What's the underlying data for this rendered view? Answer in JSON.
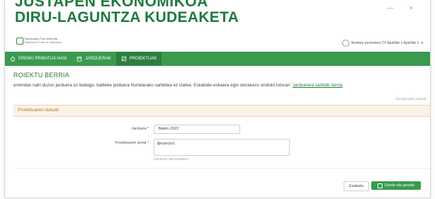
{
  "header": {
    "title_line1": "JUSTAPEN EKONOMIKOA",
    "title_line2": "DIRU-LAGUNTZA KUDEAKETA",
    "logo_line1": "Gipuzkoako Foru Aldundia",
    "logo_line2": "Diputación Foral de Gipuzkoa",
    "window_controls": "— ×",
    "user_label": "Nombre promotora TX Apellido 1 Apellido 2",
    "user_chevron": "▾"
  },
  "nav": {
    "items": [
      {
        "label": "EREMU PRIBATUA HASI",
        "icon": "home-icon"
      },
      {
        "label": "JARDUERAK",
        "icon": "calendar-icon"
      },
      {
        "label": "PROIEKTUAK",
        "icon": "edit-icon"
      }
    ],
    "active_index": 2
  },
  "page": {
    "title": "ROIEKTU BERRIA",
    "info_text": "errendan nahi duzun jarduera ez badago, baliteke jarduera horretarako sarbidea ez izatea. Eskabide-eskaera egin dezakezu ondoko loturan:",
    "info_link": "Jarduerara sarbide berria",
    "required_note": "Derrigorrezko datuak"
  },
  "form": {
    "section_title": "Proiektuaren datuak",
    "jarduera_label": "Jarduera *",
    "jarduera_value": "Ixakin 2022",
    "name_label": "Proiektuaren izena *",
    "name_value": "Proyecto1",
    "hint": "Gehienez 250 karaktere."
  },
  "buttons": {
    "clear": "Ezabatu",
    "save": "Gorde eta jarraitu"
  },
  "colors": {
    "brand_green": "#1e7a3c",
    "nav_green": "#3a9a4e",
    "section_header_bg": "#fbf3e6"
  }
}
